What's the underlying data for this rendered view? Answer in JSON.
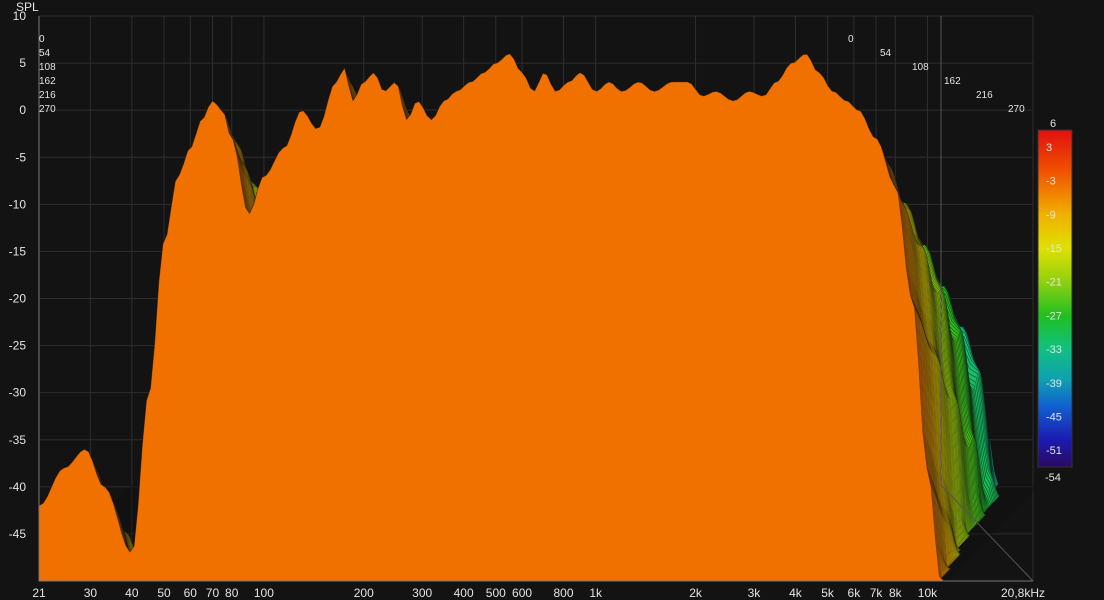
{
  "chart_data": {
    "type": "waterfall",
    "y_axis_label": "SPL",
    "y_ticks": [
      10,
      5,
      0,
      -5,
      -10,
      -15,
      -20,
      -25,
      -30,
      -35,
      -40,
      -45
    ],
    "x_ticks": [
      "21",
      "30",
      "40",
      "50",
      "60",
      "70",
      "80",
      "100",
      "200",
      "300",
      "400",
      "500",
      "600",
      "800",
      "1k",
      "2k",
      "3k",
      "4k",
      "5k",
      "6k",
      "7k",
      "8k",
      "10k",
      "20,8kHz"
    ],
    "x_tick_values": [
      21,
      30,
      40,
      50,
      60,
      70,
      80,
      100,
      200,
      300,
      400,
      500,
      600,
      800,
      1000,
      2000,
      3000,
      4000,
      5000,
      6000,
      7000,
      8000,
      10000,
      20800
    ],
    "x_range_hz": [
      21,
      20800
    ],
    "y_range_db": [
      -50,
      10
    ],
    "depth_ticks": [
      "0",
      "54",
      "108",
      "162",
      "216",
      "270"
    ],
    "depth_values": [
      0,
      54,
      108,
      162,
      216,
      270
    ],
    "slices": 90,
    "front_response_db": [
      {
        "f": 21,
        "db": -42
      },
      {
        "f": 25,
        "db": -38
      },
      {
        "f": 29,
        "db": -36
      },
      {
        "f": 33,
        "db": -40
      },
      {
        "f": 40,
        "db": -47
      },
      {
        "f": 45,
        "db": -30
      },
      {
        "f": 50,
        "db": -14
      },
      {
        "f": 55,
        "db": -7
      },
      {
        "f": 60,
        "db": -4
      },
      {
        "f": 65,
        "db": -1
      },
      {
        "f": 70,
        "db": 1
      },
      {
        "f": 75,
        "db": 0
      },
      {
        "f": 80,
        "db": -3
      },
      {
        "f": 90,
        "db": -11
      },
      {
        "f": 100,
        "db": -7
      },
      {
        "f": 115,
        "db": -4
      },
      {
        "f": 130,
        "db": 0
      },
      {
        "f": 145,
        "db": -2
      },
      {
        "f": 165,
        "db": 3
      },
      {
        "f": 175,
        "db": 4.5
      },
      {
        "f": 185,
        "db": 1
      },
      {
        "f": 200,
        "db": 3
      },
      {
        "f": 215,
        "db": 4
      },
      {
        "f": 230,
        "db": 2
      },
      {
        "f": 250,
        "db": 3
      },
      {
        "f": 270,
        "db": -1
      },
      {
        "f": 290,
        "db": 1
      },
      {
        "f": 320,
        "db": -1
      },
      {
        "f": 350,
        "db": 1
      },
      {
        "f": 380,
        "db": 2
      },
      {
        "f": 420,
        "db": 3
      },
      {
        "f": 460,
        "db": 4
      },
      {
        "f": 500,
        "db": 5
      },
      {
        "f": 550,
        "db": 6
      },
      {
        "f": 600,
        "db": 4
      },
      {
        "f": 650,
        "db": 2
      },
      {
        "f": 700,
        "db": 4
      },
      {
        "f": 760,
        "db": 2
      },
      {
        "f": 830,
        "db": 3
      },
      {
        "f": 900,
        "db": 4
      },
      {
        "f": 1000,
        "db": 2
      },
      {
        "f": 1100,
        "db": 3
      },
      {
        "f": 1200,
        "db": 2
      },
      {
        "f": 1350,
        "db": 3
      },
      {
        "f": 1500,
        "db": 2
      },
      {
        "f": 1700,
        "db": 3
      },
      {
        "f": 1900,
        "db": 3
      },
      {
        "f": 2100,
        "db": 1.5
      },
      {
        "f": 2300,
        "db": 2
      },
      {
        "f": 2600,
        "db": 1
      },
      {
        "f": 2900,
        "db": 2
      },
      {
        "f": 3200,
        "db": 1.5
      },
      {
        "f": 3500,
        "db": 3
      },
      {
        "f": 3900,
        "db": 5
      },
      {
        "f": 4300,
        "db": 6
      },
      {
        "f": 4700,
        "db": 4
      },
      {
        "f": 5200,
        "db": 2
      },
      {
        "f": 5700,
        "db": 1
      },
      {
        "f": 6200,
        "db": 0
      },
      {
        "f": 7000,
        "db": -3
      },
      {
        "f": 8000,
        "db": -8
      },
      {
        "f": 9000,
        "db": -20
      },
      {
        "f": 10000,
        "db": -38
      },
      {
        "f": 11000,
        "db": -50
      }
    ],
    "color_scale": {
      "max_label": "6",
      "min_label": "-54",
      "ticks": [
        "3",
        "-3",
        "-9",
        "-15",
        "-21",
        "-27",
        "-33",
        "-39",
        "-45",
        "-51"
      ],
      "tick_values": [
        3,
        -3,
        -9,
        -15,
        -21,
        -27,
        -33,
        -39,
        -45,
        -51
      ],
      "range_db": [
        -54,
        6
      ],
      "colors": [
        "#2a0a5e",
        "#1b1bb0",
        "#1060d0",
        "#10a0b0",
        "#10c080",
        "#20c020",
        "#80d010",
        "#e0e000",
        "#f0a000",
        "#f05000",
        "#e01010"
      ]
    },
    "grid": true
  }
}
